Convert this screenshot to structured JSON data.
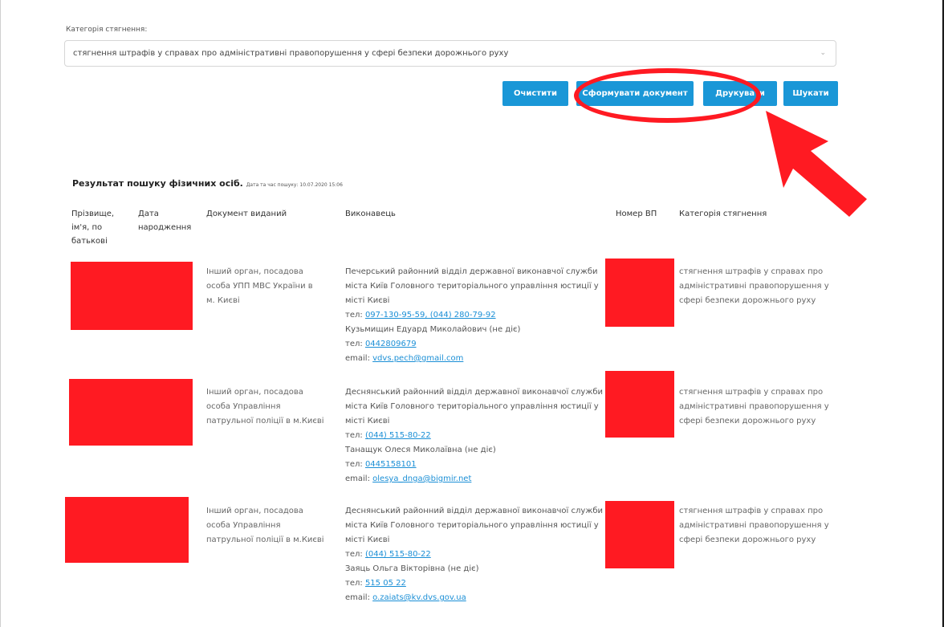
{
  "search": {
    "category_label": "Категорія стягнення:",
    "category_value": "стягнення штрафів у справах про адміністративні правопорушення у сфері безпеки дорожнього руху",
    "chevron_icon": "chevron-down-icon"
  },
  "buttons": {
    "clear": "Очистити",
    "generate": "Сформувати документ",
    "print": "Друкувати",
    "search": "Шукати"
  },
  "colors": {
    "button": "#1a97d7",
    "annotation": "#ff1a22",
    "link": "#1b8fd6"
  },
  "results": {
    "title": "Результат пошуку фізичних осіб.",
    "date_note": "Дата та час пошуку: 10.07.2020 15:06",
    "headers": {
      "name": "Прізвище, ім'я, по батькові",
      "birth": "Дата народження",
      "issued": "Документ виданий",
      "executor": "Виконавець",
      "vp": "Номер ВП",
      "category": "Категорія стягнення"
    },
    "rows": [
      {
        "issued": "Інший орган, посадова особа УПП МВС України в м. Києві",
        "executor_org": "Печерський районний відділ державної виконавчої служби міста Київ Головного територіального управління юстиції у місті Києві",
        "tel_label": "тел:",
        "tel": "097-130-95-59, (044) 280-79-92",
        "person": "Кузьмищин Едуард Миколайович (не діє)",
        "person_tel_label": "тел:",
        "person_tel": "0442809679",
        "email_label": "email:",
        "email": "vdvs.pech@gmail.com",
        "category": "стягнення штрафів у справах про адміністративні правопорушення у сфері безпеки дорожнього руху"
      },
      {
        "issued": "Інший орган, посадова особа Управління патрульної поліції в м.Києві",
        "executor_org": "Деснянський районний відділ державної виконавчої служби міста Київ Головного територіального управління юстиції у місті Києві",
        "tel_label": "тел:",
        "tel": "(044) 515-80-22",
        "person": "Танащук Олеся Миколаївна (не діє)",
        "person_tel_label": "тел:",
        "person_tel": "0445158101",
        "email_label": "email:",
        "email": "olesya_dnga@bigmir.net",
        "category": "стягнення штрафів у справах про адміністративні правопорушення у сфері безпеки дорожнього руху"
      },
      {
        "issued": "Інший орган, посадова особа Управління патрульної поліції в м.Києві",
        "executor_org": "Деснянський районний відділ державної виконавчої служби міста Київ Головного територіального управління юстиції у місті Києві",
        "tel_label": "тел:",
        "tel": "(044) 515-80-22",
        "person": "Заяць Ольга Вікторівна (не діє)",
        "person_tel_label": "тел:",
        "person_tel": "515 05 22",
        "email_label": "email:",
        "email": "o.zaiats@kv.dvs.gov.ua",
        "category": "стягнення штрафів у справах про адміністративні правопорушення у сфері безпеки дорожнього руху"
      }
    ]
  }
}
